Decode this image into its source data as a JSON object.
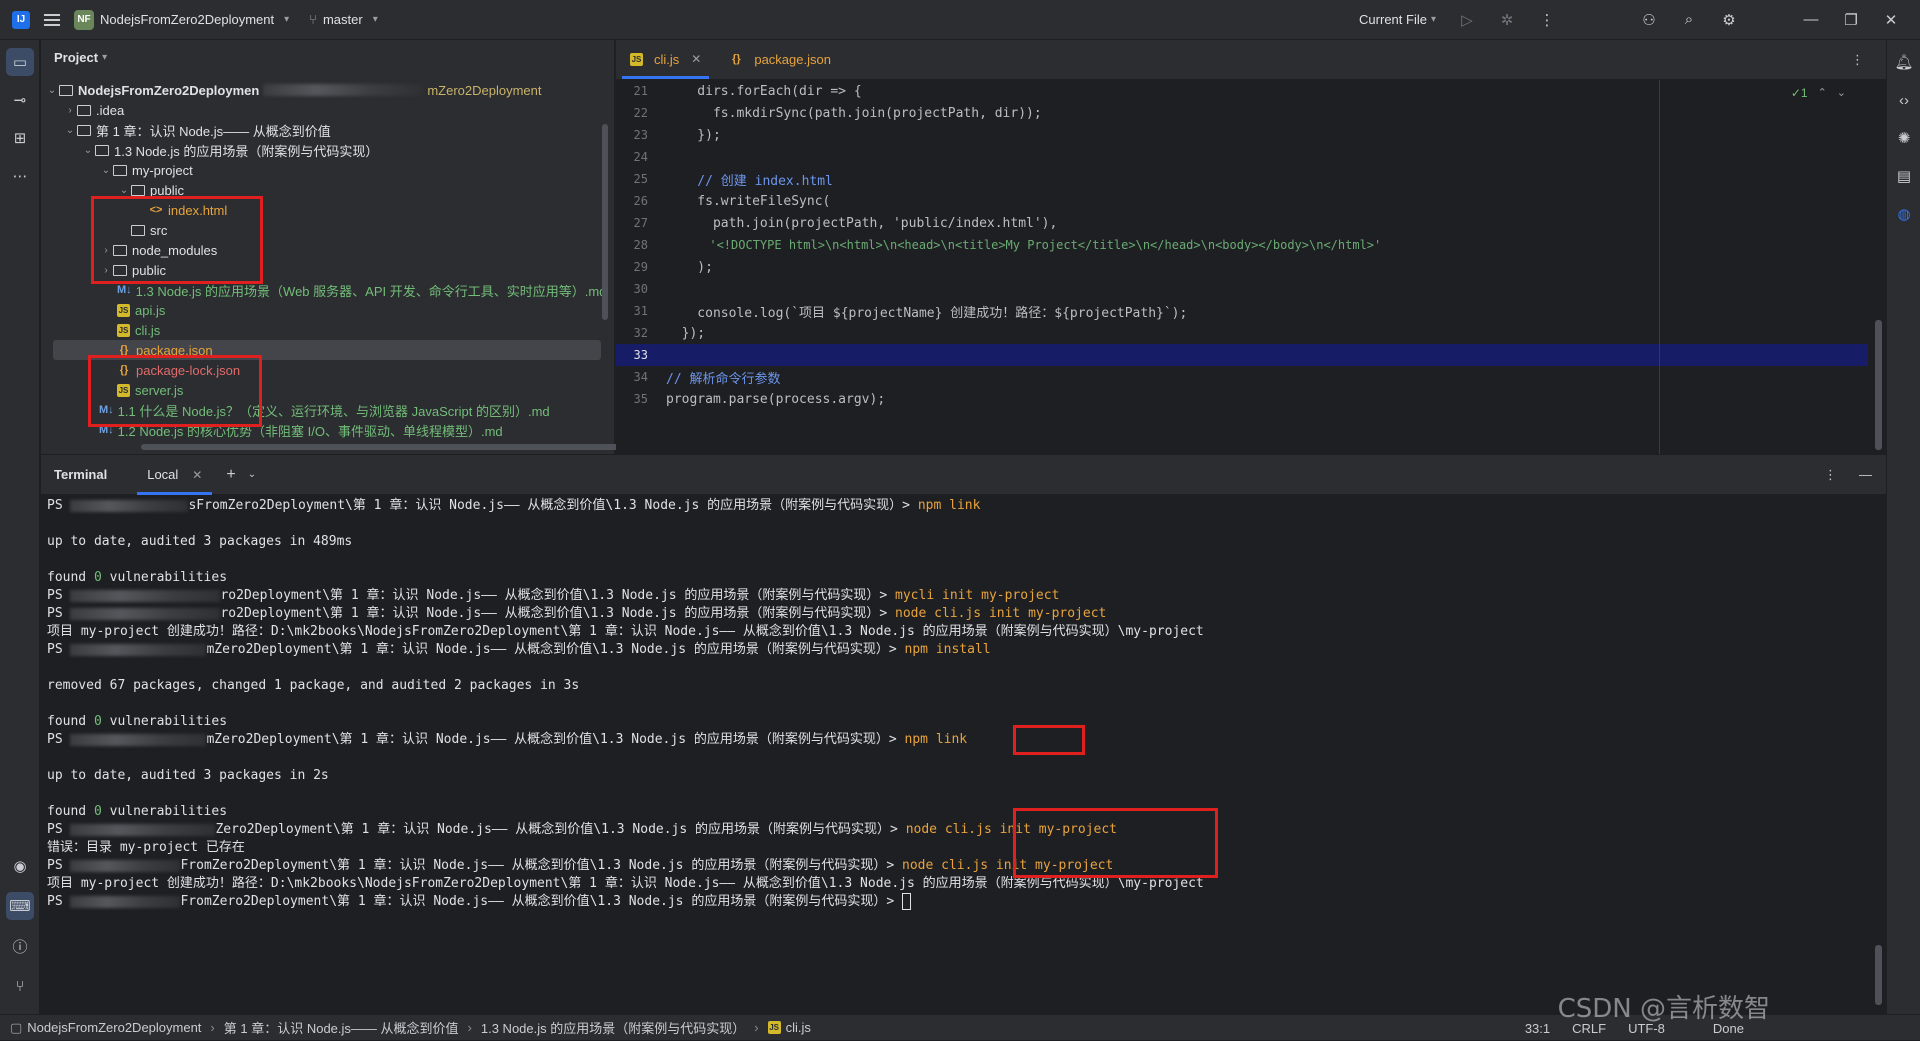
{
  "titlebar": {
    "project_badge": "NF",
    "project_name": "NodejsFromZero2Deployment",
    "branch": "master",
    "run_config": "Current File"
  },
  "project_panel": {
    "title": "Project",
    "root_name": "NodejsFromZero2Deploymen",
    "root_path": "mZero2Deployment",
    "items": [
      {
        "label": ".idea"
      },
      {
        "label": "第 1 章：认识 Node.js—— 从概念到价值"
      },
      {
        "label": "1.3 Node.js 的应用场景（附案例与代码实现）"
      },
      {
        "label": "my-project"
      },
      {
        "label": "public"
      },
      {
        "label": "index.html"
      },
      {
        "label": "src"
      },
      {
        "label": "node_modules"
      },
      {
        "label": "public"
      },
      {
        "label": "1.3 Node.js 的应用场景（Web 服务器、API 开发、命令行工具、实时应用等）.md"
      },
      {
        "label": "api.js"
      },
      {
        "label": "cli.js"
      },
      {
        "label": "package.json"
      },
      {
        "label": "package-lock.json"
      },
      {
        "label": "server.js"
      },
      {
        "label": "1.1 什么是 Node.js？（定义、运行环境、与浏览器 JavaScript 的区别）.md"
      },
      {
        "label": "1.2 Node.js 的核心优势（非阻塞 I/O、事件驱动、单线程模型）.md"
      }
    ]
  },
  "editor": {
    "tabs": [
      {
        "label": "cli.js"
      },
      {
        "label": "package.json"
      }
    ],
    "inspection": "✓1",
    "lines": [
      {
        "n": "21",
        "text": "    dirs.forEach(dir => {"
      },
      {
        "n": "22",
        "text": "      fs.mkdirSync(path.join(projectPath, dir));"
      },
      {
        "n": "23",
        "text": "    });"
      },
      {
        "n": "24",
        "text": ""
      },
      {
        "n": "25",
        "text": "    // 创建 index.html"
      },
      {
        "n": "26",
        "text": "    fs.writeFileSync("
      },
      {
        "n": "27",
        "text": "      path.join(projectPath, 'public/index.html'),"
      },
      {
        "n": "28",
        "text": "      '<!DOCTYPE html>\\n<html>\\n<head>\\n<title>My Project</title>\\n</head>\\n<body></body>\\n</html>'"
      },
      {
        "n": "29",
        "text": "    );"
      },
      {
        "n": "30",
        "text": ""
      },
      {
        "n": "31",
        "text": "    console.log(`项目 ${projectName} 创建成功！路径：${projectPath}`);"
      },
      {
        "n": "32",
        "text": "  });"
      },
      {
        "n": "33",
        "text": ""
      },
      {
        "n": "34",
        "text": "// 解析命令行参数"
      },
      {
        "n": "35",
        "text": "program.parse(process.argv);"
      }
    ]
  },
  "terminal": {
    "title": "Terminal",
    "tab": "Local",
    "ps": "PS",
    "path_a": "sFromZero2Deployment\\第 1 章：认识 Node.js—— 从概念到价值\\1.3 Node.js 的应用场景（附案例与代码实现）> ",
    "path_b": "ero2Deployment\\第 1 章：认识 Node.js—— 从概念到价值\\1.3 Node.js 的应用场景（附案例与代码实现）> ",
    "path_c": "ro2Deployment\\第 1 章：认识 Node.js—— 从概念到价值\\1.3 Node.js 的应用场景（附案例与代码实现）> ",
    "path_d": "mZero2Deployment\\第 1 章：认识 Node.js—— 从概念到价值\\1.3 Node.js 的应用场景（附案例与代码实现）> ",
    "path_e": "Zero2Deployment\\第 1 章：认识 Node.js—— 从概念到价值\\1.3 Node.js 的应用场景（附案例与代码实现）> ",
    "path_f": "FromZero2Deployment\\第 1 章：认识 Node.js—— 从概念到价值\\1.3 Node.js 的应用场景（附案例与代码实现）> ",
    "cmd_npm_link": "npm link",
    "cmd_mycli": "mycli init my-project",
    "cmd_node_cli": "node cli.js init my-project",
    "cmd_npm_install": "npm install",
    "out_uptodate_1": "up to date, audited 3 packages in 489ms",
    "out_found_a": "found ",
    "out_found_zero": "0",
    "out_found_b": " vulnerabilities",
    "out_created": "项目 my-project 创建成功！路径：D:\\mk2books\\NodejsFromZero2Deployment\\第 1 章：认识 Node.js—— 从概念到价值\\1.3 Node.js 的应用场景（附案例与代码实现）\\my-project",
    "out_removed": "removed 67 packages, changed 1 package, and audited 2 packages in 3s",
    "out_uptodate_2": "up to date, audited 3 packages in 2s",
    "out_error": "错误：目录 my-project 已存在"
  },
  "statusbar": {
    "crumbs": [
      "NodejsFromZero2Deployment",
      "第 1 章：认识 Node.js—— 从概念到价值",
      "1.3 Node.js 的应用场景（附案例与代码实现）",
      "cli.js"
    ],
    "position": "33:1",
    "line_sep": "CRLF",
    "encoding": "UTF-8",
    "done": "Done"
  },
  "watermark": "CSDN @言析数智",
  "colors": {
    "accent": "#3574f0",
    "highlight_box": "#e0201e",
    "command": "#e8a33d",
    "comment": "#6c95eb",
    "string": "#6aab73"
  }
}
